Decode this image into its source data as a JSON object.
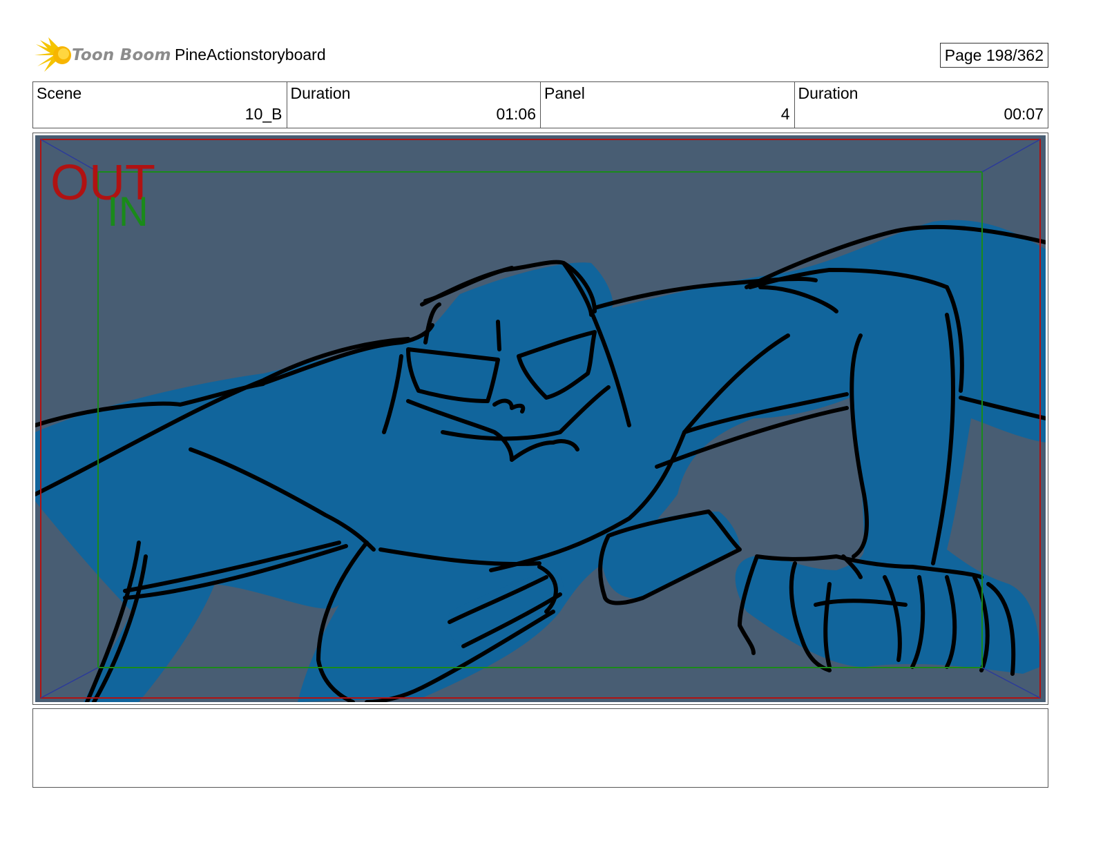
{
  "header": {
    "logo_text": "Toon Boom",
    "project_title": "PineActionstoryboard",
    "page_indicator": "Page 198/362"
  },
  "info": {
    "scene_label": "Scene",
    "scene_value": "10_B",
    "scene_duration_label": "Duration",
    "scene_duration_value": "01:06",
    "panel_label": "Panel",
    "panel_value": "4",
    "panel_duration_label": "Duration",
    "panel_duration_value": "00:07"
  },
  "panel": {
    "out_label": "OUT",
    "in_label": "IN",
    "background_color": "#485d73",
    "character_fill_color": "#11659c",
    "out_frame_color": "#b01212",
    "in_frame_color": "#1a8a1a"
  },
  "notes": {
    "text": ""
  }
}
